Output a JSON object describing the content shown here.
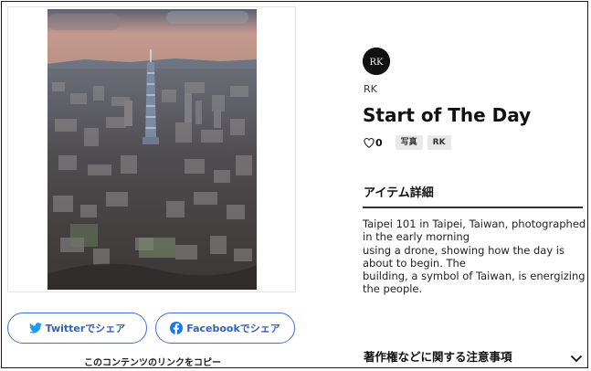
{
  "photo": {
    "alt": "Aerial view of Taipei 101 and the city at dawn"
  },
  "share": {
    "twitter_label": "Twitterでシェア",
    "facebook_label": "Facebookでシェア",
    "copy_link_label": "このコンテンツのリンクをコピー"
  },
  "author": {
    "avatar_text": "RK",
    "name": "RK"
  },
  "item": {
    "title": "Start of The Day",
    "likes": "0",
    "tags": [
      "写真",
      "RK"
    ]
  },
  "details": {
    "heading": "アイテム詳細",
    "lines": [
      "Taipei 101 in Taipei, Taiwan, photographed in the early morning",
      "using a drone, showing how the day is about to begin. The",
      "building, a symbol of Taiwan, is energizing the people."
    ]
  },
  "notice": {
    "label": "著作権などに関する注意事項"
  },
  "colors": {
    "accent": "#3a6fd8",
    "twitter": "#1d9bf0",
    "facebook": "#1877f2"
  },
  "icons": {
    "like": "heart-outline-icon",
    "twitter": "twitter-bird-icon",
    "facebook": "facebook-icon",
    "expand": "chevron-down-icon"
  }
}
